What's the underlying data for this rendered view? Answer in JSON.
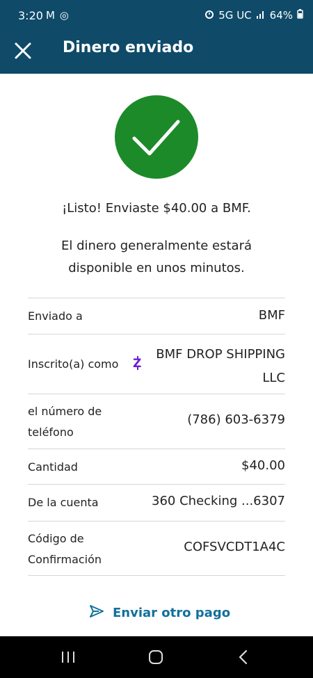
{
  "status_bar": {
    "time": "3:20",
    "left_icons": "M ◎",
    "network": "5G UC",
    "battery": "64%"
  },
  "header": {
    "title": "Dinero enviado",
    "close_icon": "close-icon",
    "background": "#0f4a69"
  },
  "success": {
    "icon": "checkmark-icon",
    "color": "#1d8a2a",
    "message": "¡Listo! Enviaste $40.00 a BMF.",
    "note": "El dinero generalmente estará disponible en unos minutos."
  },
  "details": [
    {
      "label": "Enviado a",
      "value": "BMF"
    },
    {
      "label": "Inscrito(a) como",
      "value": "BMF DROP SHIPPING LLC",
      "icon": "zelle-icon"
    },
    {
      "label": "el número de teléfono",
      "value": "(786) 603-6379"
    },
    {
      "label": "Cantidad",
      "value": "$40.00"
    },
    {
      "label": "De la cuenta",
      "value": "360 Checking ...6307"
    },
    {
      "label": "Código de Confirmación",
      "value": "COFSVCDT1A4C"
    }
  ],
  "actions": {
    "send_again_label": "Enviar otro pago",
    "send_again_icon": "send-icon",
    "accent": "#13709c"
  },
  "nav_bar": {
    "recents_icon": "recents-icon",
    "home_icon": "home-icon",
    "back_icon": "back-icon"
  }
}
